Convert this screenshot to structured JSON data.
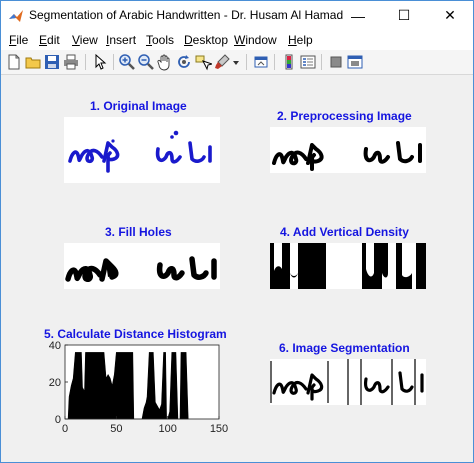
{
  "window": {
    "title": "Segmentation of Arabic Handwritten - Dr. Husam Al Hamad",
    "minimize": "—",
    "maximize": "☐",
    "close": "✕"
  },
  "menu": [
    {
      "label": "File",
      "u": "F",
      "rest": "ile"
    },
    {
      "label": "Edit",
      "u": "E",
      "rest": "dit"
    },
    {
      "label": "View",
      "u": "V",
      "rest": "iew"
    },
    {
      "label": "Insert",
      "u": "I",
      "rest": "nsert"
    },
    {
      "label": "Tools",
      "u": "T",
      "rest": "ools"
    },
    {
      "label": "Desktop",
      "u": "D",
      "rest": "esktop"
    },
    {
      "label": "Window",
      "u": "W",
      "rest": "indow"
    },
    {
      "label": "Help",
      "u": "H",
      "rest": "elp"
    }
  ],
  "toolbar": [
    "new-figure-icon",
    "open-file-icon",
    "save-icon",
    "print-icon",
    "select-arrow-icon",
    "zoom-in-icon",
    "zoom-out-icon",
    "pan-hand-icon",
    "rotate-3d-icon",
    "data-cursor-icon",
    "brush-icon",
    "dropdown-arrow-icon",
    "link-plot-icon",
    "colorbar-icon",
    "legend-icon",
    "hide-plot-tools-icon",
    "show-plot-tools-icon"
  ],
  "panels": {
    "p1": {
      "title": "1. Original Image"
    },
    "p2": {
      "title": "2. Preprocessing Image"
    },
    "p3": {
      "title": "3. Fill Holes"
    },
    "p4": {
      "title": "4. Add Vertical Density"
    },
    "p5": {
      "title": "5. Calculate Distance Histogram"
    },
    "p6": {
      "title": "6. Image Segmentation"
    }
  },
  "colors": {
    "title_blue": "#1515e0",
    "ink_blue": "#1a1acc",
    "ink_black": "#000000"
  },
  "chart_data": {
    "type": "area",
    "title": "5. Calculate Distance Histogram",
    "xlabel": "",
    "ylabel": "",
    "xlim": [
      0,
      150
    ],
    "ylim": [
      0,
      40
    ],
    "xticks": [
      0,
      50,
      100,
      150
    ],
    "yticks": [
      0,
      20,
      40
    ],
    "grid": false,
    "series": [
      {
        "x": [
          0,
          3,
          4,
          6,
          8,
          10,
          12,
          14,
          16,
          17,
          19,
          20,
          22,
          24,
          25,
          27,
          30,
          32,
          35,
          38,
          40,
          42,
          44,
          46,
          48,
          50,
          52,
          55,
          58,
          60,
          62,
          64,
          66,
          67,
          70,
          74,
          75,
          77,
          79,
          80,
          82,
          84,
          86,
          88,
          90,
          92,
          94,
          96,
          98,
          99,
          100,
          102,
          104,
          106,
          108,
          110,
          112,
          113,
          114,
          116,
          118,
          120
        ],
        "y": [
          0,
          0,
          12,
          18,
          22,
          36,
          36,
          36,
          36,
          17,
          15,
          36,
          36,
          36,
          36,
          36,
          36,
          36,
          36,
          36,
          22,
          24,
          22,
          18,
          24,
          36,
          36,
          36,
          36,
          36,
          36,
          36,
          36,
          0,
          0,
          0,
          0,
          6,
          9,
          12,
          36,
          36,
          36,
          9,
          7,
          5,
          8,
          36,
          36,
          0,
          0,
          4,
          36,
          36,
          36,
          0,
          0,
          36,
          36,
          36,
          36,
          0
        ]
      }
    ]
  }
}
